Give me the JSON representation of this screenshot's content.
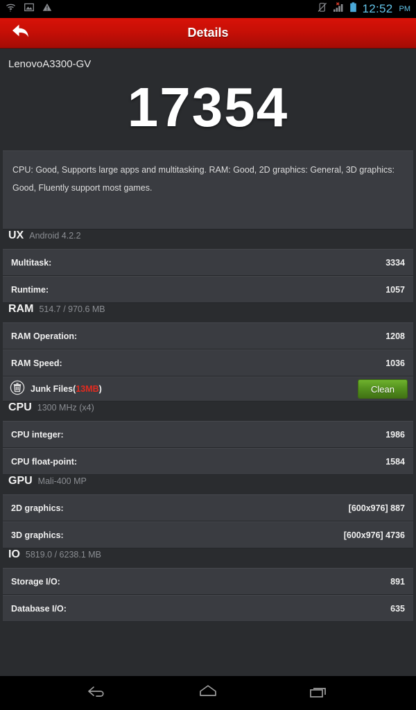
{
  "statusbar": {
    "left_icons": [
      "wifi-unknown-icon",
      "image-icon",
      "warning-icon"
    ],
    "right_icons": [
      "vibrate-icon",
      "signal-no-service-icon",
      "battery-icon"
    ],
    "time": "12:52",
    "ampm": "PM",
    "time_color": "#62c3e8"
  },
  "titlebar": {
    "back_icon": "back-arrow-icon",
    "title": "Details",
    "accent_color": "#c50f06"
  },
  "device": {
    "name": "LenovoA3300-GV"
  },
  "score": {
    "total": "17354"
  },
  "summary": {
    "text": "CPU: Good, Supports large apps and multitasking. RAM: Good, 2D graphics: General, 3D graphics: Good, Fluently support most games."
  },
  "sections": [
    {
      "name": "UX",
      "subtitle": "Android 4.2.2",
      "rows": [
        {
          "label": "Multitask:",
          "value": "3334"
        },
        {
          "label": "Runtime:",
          "value": "1057"
        }
      ]
    },
    {
      "name": "RAM",
      "subtitle": "514.7 / 970.6 MB",
      "rows": [
        {
          "label": "RAM Operation:",
          "value": "1208"
        },
        {
          "label": "RAM Speed:",
          "value": "1036"
        }
      ],
      "junk": {
        "icon": "trash-can-icon",
        "label_prefix": "Junk Files(",
        "size": "13MB",
        "label_suffix": ")",
        "button_label": "Clean",
        "button_color": "#55921f",
        "size_color": "#e22b20"
      }
    },
    {
      "name": "CPU",
      "subtitle": "1300 MHz (x4)",
      "rows": [
        {
          "label": "CPU integer:",
          "value": "1986"
        },
        {
          "label": "CPU float-point:",
          "value": "1584"
        }
      ]
    },
    {
      "name": "GPU",
      "subtitle": "Mali-400 MP",
      "rows": [
        {
          "label": "2D graphics:",
          "value": "[600x976] 887"
        },
        {
          "label": "3D graphics:",
          "value": "[600x976] 4736"
        }
      ]
    },
    {
      "name": "IO",
      "subtitle": "5819.0 / 6238.1 MB",
      "rows": [
        {
          "label": "Storage I/O:",
          "value": "891"
        },
        {
          "label": "Database I/O:",
          "value": "635"
        }
      ]
    }
  ],
  "navbar": {
    "buttons": [
      "back-nav-icon",
      "home-nav-icon",
      "recents-nav-icon"
    ]
  }
}
